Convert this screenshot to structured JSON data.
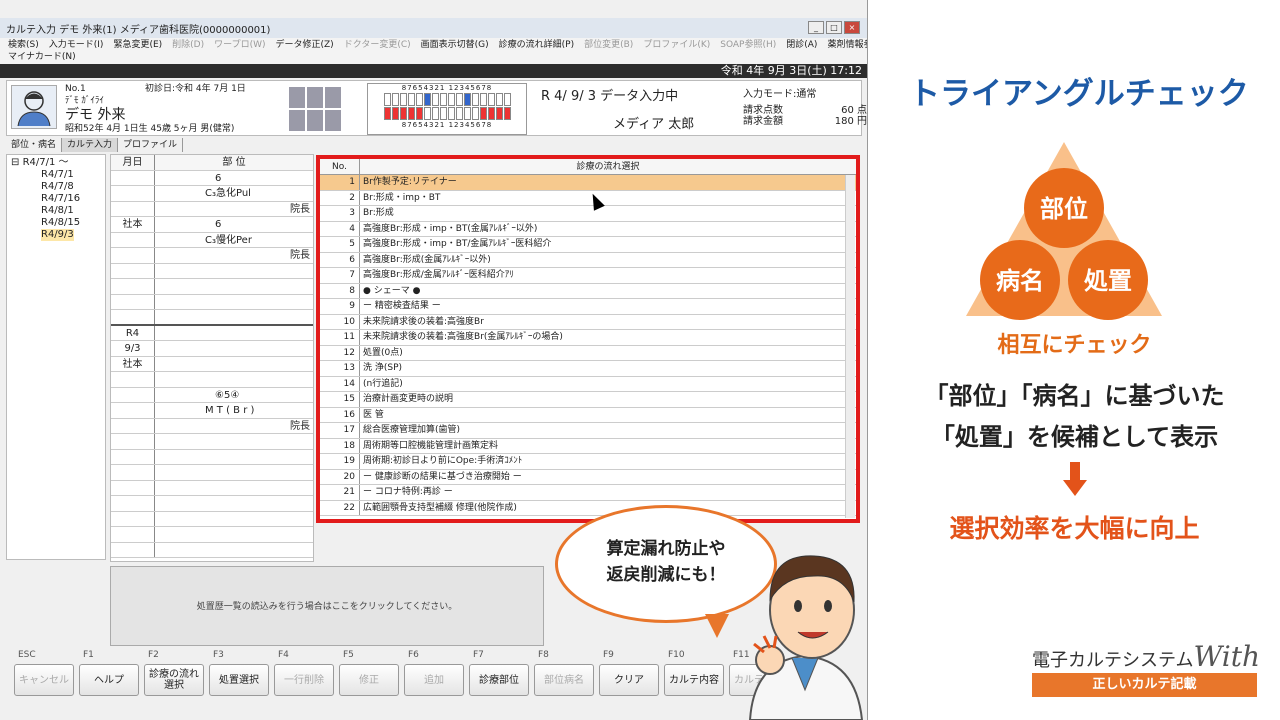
{
  "app": {
    "title": "カルテ入力 デモ 外来(1) メディア歯科医院(0000000001)",
    "menu_row1": [
      "検索(S)",
      "入力モード(I)",
      "緊急変更(E)",
      "削除(D)",
      "ワープロ(W)",
      "データ修正(Z)",
      "ドクター変更(C)",
      "画面表示切替(G)",
      "診療の流れ詳細(P)",
      "部位変更(B)",
      "プロファイル(K)",
      "SOAP参照(H)",
      "閉診(A)",
      "薬剤情報参照(Y)"
    ],
    "menu_row2": [
      "マイナカード(N)"
    ],
    "datetime": "令和 4年 9月 3日(土) 17:12"
  },
  "patient": {
    "no": "No.1",
    "first_visit": "初診日:令和 4年 7月 1日",
    "kana": "ﾃﾞﾓ ｶﾞｲﾗｲ",
    "name": "デモ 外来",
    "birth": "昭和52年 4月 1日生 45歳 5ヶ月 男(健常)"
  },
  "status": {
    "state": "R 4/ 9/ 3 データ入力中",
    "doctor": "メディア 太郎",
    "mode": "入力モード:通常",
    "points_label": "請求点数",
    "points": "60 点",
    "amount_label": "請求金額",
    "amount": "180 円"
  },
  "tabs": [
    "部位・病名",
    "カルテ入力",
    "プロファイル"
  ],
  "tree": {
    "root": "R4/7/1 ～",
    "children": [
      "R4/7/1",
      "R4/7/8",
      "R4/7/16",
      "R4/8/1",
      "R4/8/15",
      "R4/9/3"
    ]
  },
  "record": {
    "header_date": "月日",
    "header_site": "部 位",
    "rows": [
      {
        "c1": "",
        "c2": "6"
      },
      {
        "c1": "",
        "c2": "C₃急化Pul"
      },
      {
        "c1": "",
        "c2": "院長"
      },
      {
        "c1": "社本",
        "c2": "6"
      },
      {
        "c1": "",
        "c2": "C₃慢化Per"
      },
      {
        "c1": "",
        "c2": "院長"
      },
      {
        "c1": "",
        "c2": ""
      },
      {
        "c1": "",
        "c2": ""
      },
      {
        "c1": "",
        "c2": ""
      },
      {
        "c1": "",
        "c2": ""
      },
      {
        "c1": "R4",
        "c2": ""
      },
      {
        "c1": "9/3",
        "c2": ""
      },
      {
        "c1": "社本",
        "c2": ""
      },
      {
        "c1": "",
        "c2": ""
      },
      {
        "c1": "",
        "c2": "⑥5④"
      },
      {
        "c1": "",
        "c2": "M T ( B r )"
      },
      {
        "c1": "",
        "c2": "院長"
      },
      {
        "c1": "",
        "c2": ""
      },
      {
        "c1": "",
        "c2": ""
      },
      {
        "c1": "",
        "c2": ""
      },
      {
        "c1": "",
        "c2": ""
      },
      {
        "c1": "",
        "c2": ""
      },
      {
        "c1": "",
        "c2": ""
      },
      {
        "c1": "",
        "c2": ""
      },
      {
        "c1": "",
        "c2": ""
      }
    ]
  },
  "flow_list": {
    "header_no": "No.",
    "header_title": "診療の流れ選択",
    "rows": [
      {
        "no": "1",
        "text": "Br作製予定:リテイナー",
        "selected": true
      },
      {
        "no": "2",
        "text": "Br:形成・imp・BT"
      },
      {
        "no": "3",
        "text": "Br:形成"
      },
      {
        "no": "4",
        "text": "高強度Br:形成・imp・BT(金属ｱﾚﾙｷﾞｰ以外)"
      },
      {
        "no": "5",
        "text": "高強度Br:形成・imp・BT/金属ｱﾚﾙｷﾞｰ医科紹介"
      },
      {
        "no": "6",
        "text": "高強度Br:形成(金属ｱﾚﾙｷﾞｰ以外)"
      },
      {
        "no": "7",
        "text": "高強度Br:形成/金属ｱﾚﾙｷﾞｰ医科紹介ｱﾘ"
      },
      {
        "no": "8",
        "text": "● シェーマ ●"
      },
      {
        "no": "9",
        "text": " ー 精密検査結果 ー"
      },
      {
        "no": "10",
        "text": "未来院請求後の装着:高強度Br"
      },
      {
        "no": "11",
        "text": "未来院請求後の装着:高強度Br(金属ｱﾚﾙｷﾞｰの場合)"
      },
      {
        "no": "12",
        "text": "処置(0点)"
      },
      {
        "no": "13",
        "text": "洗 浄(SP)"
      },
      {
        "no": "14",
        "text": "(n行追記)"
      },
      {
        "no": "15",
        "text": "治療計画変更時の説明"
      },
      {
        "no": "16",
        "text": "医 管"
      },
      {
        "no": "17",
        "text": "総合医療管理加算(歯管)"
      },
      {
        "no": "18",
        "text": "周術期等口腔機能管理計画策定料"
      },
      {
        "no": "19",
        "text": "周術期:初診日より前にOpe:手術済ｺﾒﾝﾄ"
      },
      {
        "no": "20",
        "text": "ー 健康診断の結果に基づき治療開始 ー"
      },
      {
        "no": "21",
        "text": "ー コロナ特例:再診 ー"
      },
      {
        "no": "22",
        "text": "広範囲顎骨支持型補綴 修理(他院作成)"
      }
    ]
  },
  "history_hint": "処置歴一覧の読込みを行う場合はここをクリックしてください。",
  "fkeys": [
    {
      "key": "ESC",
      "label": "キャンセル",
      "disabled": true
    },
    {
      "key": "F1",
      "label": "ヘルプ"
    },
    {
      "key": "F2",
      "label": "診療の流れ選択"
    },
    {
      "key": "F3",
      "label": "処置選択"
    },
    {
      "key": "F4",
      "label": "一行削除",
      "disabled": true
    },
    {
      "key": "F5",
      "label": "修正",
      "disabled": true
    },
    {
      "key": "F6",
      "label": "追加",
      "disabled": true
    },
    {
      "key": "F7",
      "label": "診療部位"
    },
    {
      "key": "F8",
      "label": "部位病名",
      "disabled": true
    },
    {
      "key": "F9",
      "label": "クリア"
    },
    {
      "key": "F10",
      "label": "カルテ内容"
    },
    {
      "key": "F11",
      "label": "カルテ確定",
      "disabled": true
    }
  ],
  "bubble": {
    "line1": "算定漏れ防止や",
    "line2": "返戻削減にも！"
  },
  "panel": {
    "title": "トライアングルチェック",
    "tri_top": "部位",
    "tri_left": "病名",
    "tri_right": "処置",
    "mutual": "相互にチェック",
    "line1": "「部位」「病名」に基づいた",
    "line2": "「処置」を候補として表示",
    "result": "選択効率を大幅に向上",
    "brand": "電子カルテシステム",
    "brand_with": "With",
    "brand_sub": "正しいカルテ記載"
  },
  "colors": {
    "accent": "#e8762b",
    "title_blue": "#1d5aa6",
    "selection": "#f6c98e",
    "redbox": "#e21b1b"
  }
}
